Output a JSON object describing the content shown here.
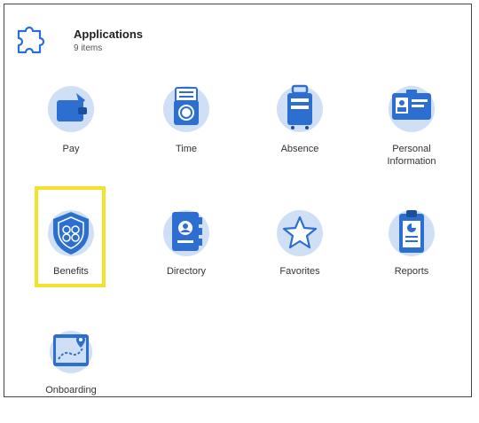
{
  "header": {
    "title": "Applications",
    "count": "9 items",
    "icon": "puzzle-icon"
  },
  "apps": [
    {
      "label": "Pay",
      "icon": "wallet-icon"
    },
    {
      "label": "Time",
      "icon": "clock-icon"
    },
    {
      "label": "Absence",
      "icon": "suitcase-icon"
    },
    {
      "label": "Personal",
      "label2": "Information",
      "icon": "id-card-icon"
    },
    {
      "label": "Benefits",
      "icon": "shield-icon"
    },
    {
      "label": "Directory",
      "icon": "directory-book-icon"
    },
    {
      "label": "Favorites",
      "icon": "star-icon"
    },
    {
      "label": "Reports",
      "icon": "clipboard-report-icon"
    },
    {
      "label": "Onboarding",
      "icon": "onboarding-map-icon"
    }
  ],
  "colors": {
    "primary": "#2d6fd0",
    "light": "#cfe0f6",
    "highlight": "#f2e22c"
  }
}
